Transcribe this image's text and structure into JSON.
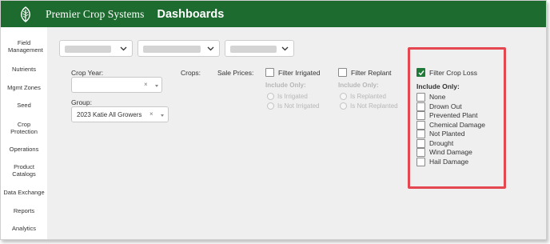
{
  "header": {
    "brand": "Premier Crop Systems",
    "title": "Dashboards"
  },
  "sidebar": {
    "items": [
      {
        "label": "Field Management"
      },
      {
        "label": "Nutrients"
      },
      {
        "label": "Mgmt Zones"
      },
      {
        "label": "Seed"
      },
      {
        "label": "Crop Protection"
      },
      {
        "label": "Operations"
      },
      {
        "label": "Product Catalogs"
      },
      {
        "label": "Data Exchange"
      },
      {
        "label": "Reports"
      },
      {
        "label": "Analytics"
      }
    ]
  },
  "filters": {
    "crop_year_label": "Crop Year:",
    "crop_year_value": "",
    "group_label": "Group:",
    "group_value": "2023 Katie All Growers",
    "crops_label": "Crops:",
    "sale_prices_label": "Sale Prices:",
    "irrigated": {
      "label": "Filter Irrigated",
      "include_only": "Include Only:",
      "options": [
        "Is Irrigated",
        "Is Not Irrigated"
      ]
    },
    "replant": {
      "label": "Filter Replant",
      "include_only": "Include Only:",
      "options": [
        "Is Replanted",
        "Is Not Replanted"
      ]
    },
    "crop_loss": {
      "label": "Filter Crop Loss",
      "checked": true,
      "include_only": "Include Only:",
      "options": [
        "None",
        "Drown Out",
        "Prevented Plant",
        "Chemical Damage",
        "Not Planted",
        "Drought",
        "Wind Damage",
        "Hail Damage"
      ]
    }
  },
  "colors": {
    "header": "#1e6b30",
    "highlight": "#e4474f",
    "checkbox_checked": "#1e7a36"
  },
  "icons": [
    "leaf-logo-icon",
    "chevron-down-icon",
    "clear-x-icon",
    "caret-down-icon",
    "checkmark-icon"
  ]
}
